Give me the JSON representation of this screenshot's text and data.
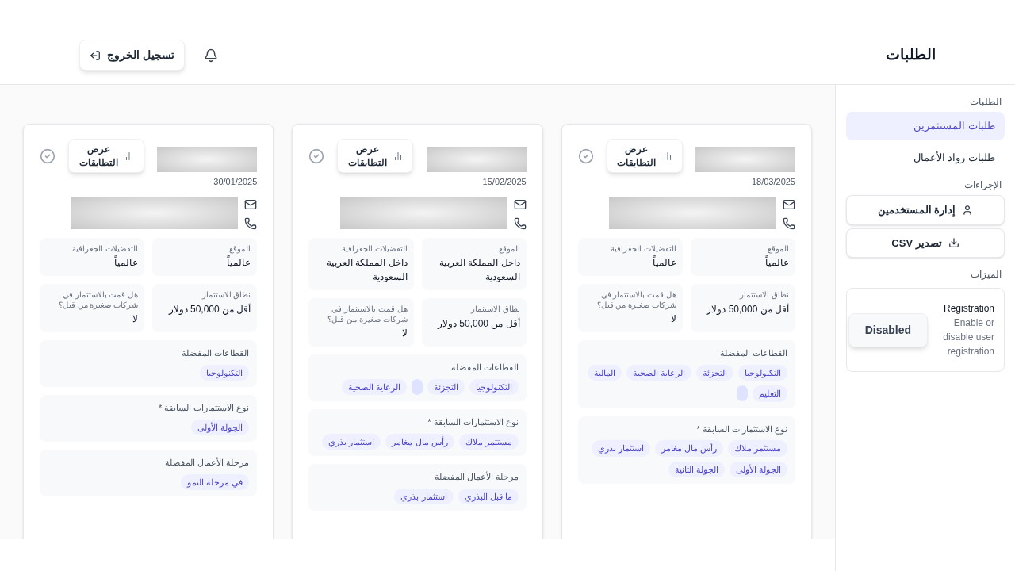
{
  "header": {
    "title": "الطلبات",
    "logout": "تسجيل الخروج"
  },
  "sidebar": {
    "sections": [
      {
        "label": "الطلبات",
        "kind": "nav",
        "items": [
          {
            "label": "طلبات المستثمرين",
            "selected": true
          },
          {
            "label": "طلبات رواد الأعمال",
            "selected": false
          }
        ]
      },
      {
        "label": "الإجراءات",
        "kind": "actions",
        "items": [
          {
            "label": "إدارة المستخدمين"
          },
          {
            "label": "تصدير CSV"
          }
        ]
      },
      {
        "label": "الميزات",
        "kind": "features",
        "items": [
          {
            "title": "Registration",
            "description": "Enable or disable user registration",
            "button": "Disabled"
          }
        ]
      }
    ]
  },
  "cards": [
    {
      "date": "18/03/2025",
      "match_button": "عرض التطابقات",
      "info": [
        {
          "label": "الموقع",
          "value": "عالمياً"
        },
        {
          "label": "التفضيلات الجغرافية",
          "value": "عالمياً"
        },
        {
          "label": "نطاق الاستثمار",
          "value": "أقل من 50,000 دولار"
        },
        {
          "label": "هل قمت بالاستثمار في شركات صغيرة من قبل؟",
          "value": "لا"
        }
      ],
      "sections": [
        {
          "label": "القطاعات المفضلة",
          "tags": [
            {
              "kind": "text",
              "label": "التكنولوجيا"
            },
            {
              "kind": "text",
              "label": "التجزئة"
            },
            {
              "kind": "text",
              "label": "الرعاية الصحية"
            },
            {
              "kind": "text",
              "label": "المالية"
            },
            {
              "kind": "text",
              "label": "التعليم"
            },
            {
              "kind": "blank"
            }
          ]
        },
        {
          "label": "نوع الاستثمارات السابقة *",
          "tags": [
            {
              "kind": "text",
              "label": "مستثمر ملاك"
            },
            {
              "kind": "text",
              "label": "رأس مال مغامر"
            },
            {
              "kind": "text",
              "label": "استثمار بذري"
            },
            {
              "kind": "text",
              "label": "الجولة الأولى"
            },
            {
              "kind": "text",
              "label": "الجولة الثانية"
            }
          ]
        }
      ]
    },
    {
      "date": "15/02/2025",
      "match_button": "عرض التطابقات",
      "info": [
        {
          "label": "الموقع",
          "value": "داخل المملكة العربية السعودية"
        },
        {
          "label": "التفضيلات الجغرافية",
          "value": "داخل المملكة العربية السعودية"
        },
        {
          "label": "نطاق الاستثمار",
          "value": "أقل من 50,000 دولار"
        },
        {
          "label": "هل قمت بالاستثمار في شركات صغيرة من قبل؟",
          "value": "لا"
        }
      ],
      "sections": [
        {
          "label": "القطاعات المفضلة",
          "tags": [
            {
              "kind": "text",
              "label": "التكنولوجيا"
            },
            {
              "kind": "text",
              "label": "التجزئة"
            },
            {
              "kind": "blank"
            },
            {
              "kind": "text",
              "label": "الرعاية الصحية"
            }
          ]
        },
        {
          "label": "نوع الاستثمارات السابقة *",
          "tags": [
            {
              "kind": "text",
              "label": "مستثمر ملاك"
            },
            {
              "kind": "text",
              "label": "رأس مال مغامر"
            },
            {
              "kind": "text",
              "label": "استثمار بذري"
            }
          ]
        },
        {
          "label": "مرحلة الأعمال المفضلة",
          "tags": [
            {
              "kind": "text",
              "label": "ما قبل البذري"
            },
            {
              "kind": "text",
              "label": "استثمار بذري"
            }
          ]
        }
      ]
    },
    {
      "date": "30/01/2025",
      "match_button": "عرض التطابقات",
      "info": [
        {
          "label": "الموقع",
          "value": "عالمياً"
        },
        {
          "label": "التفضيلات الجغرافية",
          "value": "عالمياً"
        },
        {
          "label": "نطاق الاستثمار",
          "value": "أقل من 50,000 دولار"
        },
        {
          "label": "هل قمت بالاستثمار في شركات صغيرة من قبل؟",
          "value": "لا"
        }
      ],
      "sections": [
        {
          "label": "القطاعات المفضلة",
          "tags": [
            {
              "kind": "text",
              "label": "التكنولوجيا"
            }
          ]
        },
        {
          "label": "نوع الاستثمارات السابقة *",
          "tags": [
            {
              "kind": "text",
              "label": "الجولة الأولى"
            }
          ]
        },
        {
          "label": "مرحلة الأعمال المفضلة",
          "tags": [
            {
              "kind": "text",
              "label": "في مرحلة النمو"
            }
          ]
        }
      ]
    }
  ]
}
